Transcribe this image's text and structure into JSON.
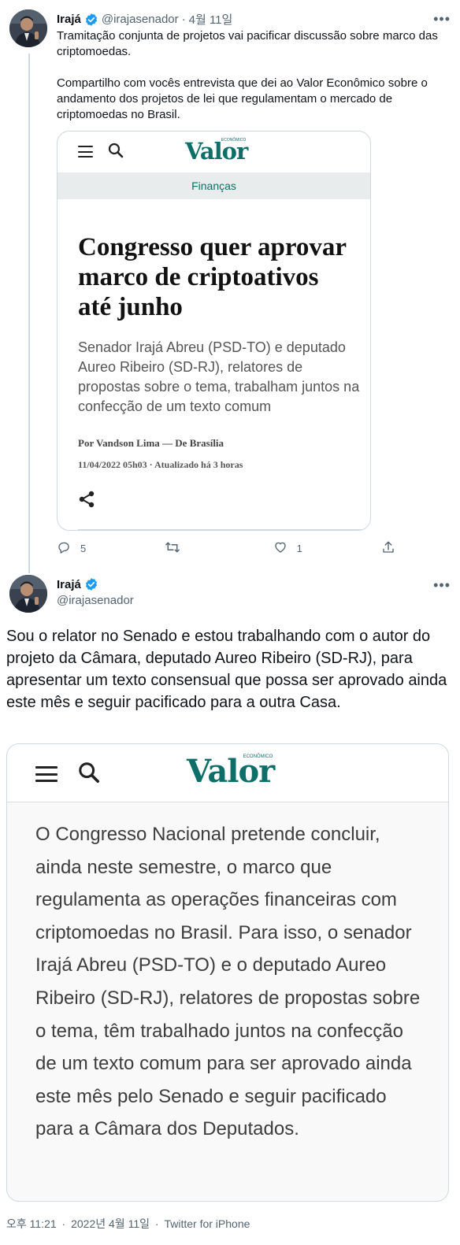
{
  "tweet1": {
    "name": "Irajá",
    "handle": "@irajasenador",
    "separator": "·",
    "date": "4월 11일",
    "more": "•••",
    "paragraphs": [
      "Tramitação conjunta de projetos vai pacificar discussão sobre marco das criptomoedas.",
      "Compartilho com vocês entrevista que dei ao Valor Econômico sobre o andamento dos projetos de lei que regulamentam o mercado de criptomoedas no Brasil."
    ],
    "card": {
      "logo": "Valor",
      "logo_small": "ECONÔMICO",
      "section": "Finanças",
      "headline": "Congresso quer aprovar marco de criptoativos até junho",
      "subhead": "Senador Irajá Abreu (PSD-TO) e deputado Aureo Ribeiro (SD-RJ), relatores de propostas sobre o tema, trabalham juntos na confecção de um texto comum",
      "byline": "Por Vandson Lima — De Brasília",
      "timestamp": "11/04/2022 05h03 · Atualizado há 3 horas"
    },
    "actions": {
      "replies": "5",
      "retweets": "",
      "likes": "1"
    }
  },
  "tweet2": {
    "name": "Irajá",
    "handle": "@irajasenador",
    "more": "•••",
    "text": "Sou o relator no Senado e estou trabalhando com o autor do projeto da Câmara, deputado Aureo Ribeiro (SD-RJ), para apresentar um texto consensual que possa ser aprovado ainda este mês e seguir pacificado para a outra Casa.",
    "card": {
      "logo": "Valor",
      "logo_small": "ECONÔMICO",
      "body": "O Congresso Nacional pretende concluir, ainda neste semestre, o marco que regulamenta as operações financeiras com criptomoedas no Brasil. Para isso, o senador Irajá Abreu (PSD-TO) e o deputado Aureo Ribeiro (SD-RJ), relatores de propostas sobre o tema, têm trabalhado juntos na confecção de um texto comum para ser aprovado ainda este mês pelo Senado e seguir pacificado para a Câmara dos Deputados."
    },
    "meta": {
      "time": "오후 11:21",
      "separator": "·",
      "date": "2022년 4월 11일",
      "source": "Twitter for iPhone"
    }
  },
  "colors": {
    "verified": "#1d9bf0",
    "valor_green": "#0e6e68",
    "muted": "#536471"
  },
  "icons": [
    "verified-badge-icon",
    "more-icon",
    "hamburger-menu-icon",
    "search-icon",
    "share-icon",
    "reply-icon",
    "retweet-icon",
    "like-icon",
    "share-tweet-icon"
  ]
}
